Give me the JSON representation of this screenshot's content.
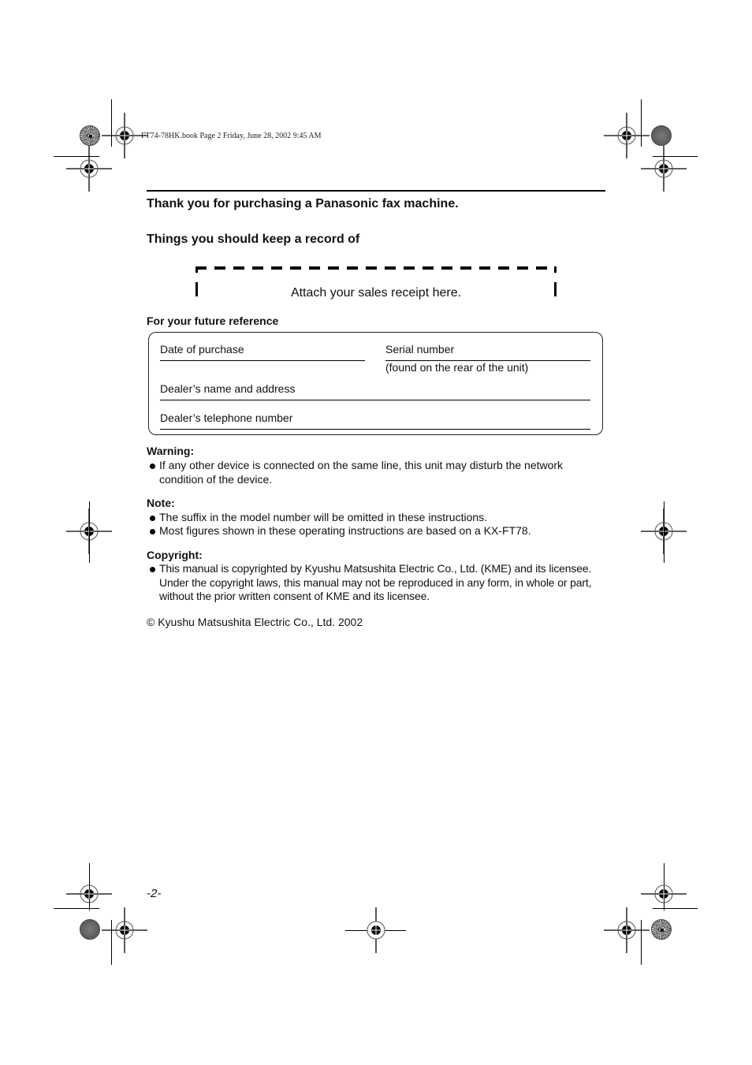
{
  "print_header": {
    "book_info": "FT74-78HK.book  Page 2  Friday, June 28, 2002  9:45 AM"
  },
  "intro": {
    "thank_you": "Thank you for purchasing a Panasonic fax machine.",
    "keep_record_heading": "Things you should keep a record of",
    "receipt_placeholder": "Attach your sales receipt here."
  },
  "reference": {
    "title": "For your future reference",
    "fields": {
      "date_of_purchase": "Date of purchase",
      "serial_number": "Serial number",
      "serial_note": "(found on the rear of the unit)",
      "dealer_name_address": "Dealer’s name and address",
      "dealer_phone": "Dealer’s telephone number"
    }
  },
  "warning": {
    "title": "Warning:",
    "items": [
      "If any other device is connected on the same line, this unit may disturb the network condition of the device."
    ]
  },
  "note": {
    "title": "Note:",
    "items": [
      "The suffix in the model number will be omitted in these instructions.",
      "Most figures shown in these operating instructions are based on a KX-FT78."
    ]
  },
  "copyright": {
    "title": "Copyright:",
    "items": [
      "This manual is copyrighted by Kyushu Matsushita Electric Co., Ltd. (KME) and its licensee. Under the copyright laws, this manual may not be reproduced in any form, in whole or part, without the prior written consent of KME and its licensee."
    ],
    "notice": "© Kyushu Matsushita Electric Co., Ltd. 2002"
  },
  "footer": {
    "page_number": "-2-"
  }
}
